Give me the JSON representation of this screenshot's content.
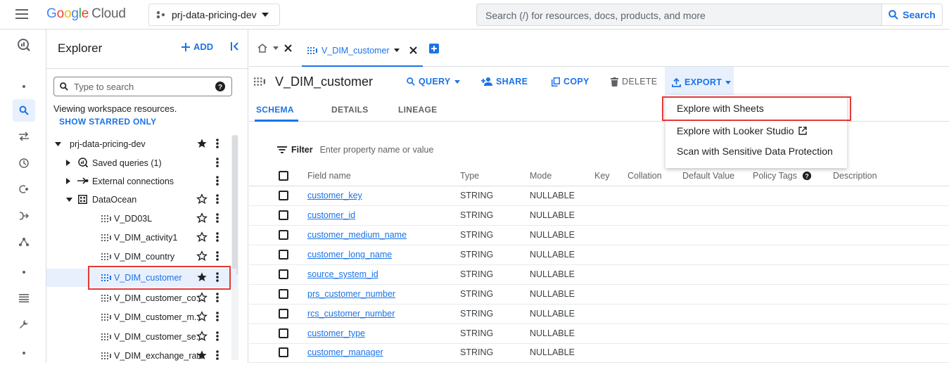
{
  "topbar": {
    "logo_g": "G",
    "logo_o1": "o",
    "logo_o2": "o",
    "logo_g2": "g",
    "logo_l": "l",
    "logo_e": "e",
    "logo_cloud": "Cloud",
    "project": "prj-data-pricing-dev",
    "search_placeholder": "Search (/) for resources, docs, products, and more",
    "search_button": "Search"
  },
  "rail": {
    "icons": [
      "bigquery-logo-icon",
      "dot-icon",
      "search-icon",
      "transfer-icon",
      "history-icon",
      "analytics-hub-icon",
      "dataflow-icon",
      "graph-icon",
      "dot-icon",
      "list-icon",
      "wrench-icon",
      "dot-icon"
    ]
  },
  "explorer": {
    "title": "Explorer",
    "add_label": "ADD",
    "search_placeholder": "Type to search",
    "workspace_text": "Viewing workspace resources.",
    "show_starred": "SHOW STARRED ONLY",
    "tree": [
      {
        "label": "prj-data-pricing-dev",
        "starred": true
      },
      {
        "label": "Saved queries (1)"
      },
      {
        "label": "External connections"
      },
      {
        "label": "DataOcean",
        "starred": false
      },
      {
        "label": "V_DD03L",
        "starred": false
      },
      {
        "label": "V_DIM_activity1",
        "starred": false
      },
      {
        "label": "V_DIM_country",
        "starred": false
      },
      {
        "label": "V_DIM_customer",
        "starred": true
      },
      {
        "label": "V_DIM_customer_co...",
        "starred": false
      },
      {
        "label": "V_DIM_customer_m...",
        "starred": false
      },
      {
        "label": "V_DIM_customer_se...",
        "starred": false
      },
      {
        "label": "V_DIM_exchange_rate",
        "starred": true
      }
    ]
  },
  "tabs": {
    "active": "V_DIM_customer"
  },
  "toolbar": {
    "title": "V_DIM_customer",
    "query": "QUERY",
    "share": "SHARE",
    "copy": "COPY",
    "delete": "DELETE",
    "export": "EXPORT"
  },
  "subtabs": [
    "SCHEMA",
    "DETAILS",
    "LINEAGE"
  ],
  "filter": {
    "label": "Filter",
    "placeholder": "Enter property name or value"
  },
  "table": {
    "headers": [
      "Field name",
      "Type",
      "Mode",
      "Key",
      "Collation",
      "Default Value",
      "Policy Tags",
      "Description"
    ],
    "rows": [
      {
        "name": "customer_key",
        "type": "STRING",
        "mode": "NULLABLE"
      },
      {
        "name": "customer_id",
        "type": "STRING",
        "mode": "NULLABLE"
      },
      {
        "name": "customer_medium_name",
        "type": "STRING",
        "mode": "NULLABLE"
      },
      {
        "name": "customer_long_name",
        "type": "STRING",
        "mode": "NULLABLE"
      },
      {
        "name": "source_system_id",
        "type": "STRING",
        "mode": "NULLABLE"
      },
      {
        "name": "prs_customer_number",
        "type": "STRING",
        "mode": "NULLABLE"
      },
      {
        "name": "rcs_customer_number",
        "type": "STRING",
        "mode": "NULLABLE"
      },
      {
        "name": "customer_type",
        "type": "STRING",
        "mode": "NULLABLE"
      },
      {
        "name": "customer_manager",
        "type": "STRING",
        "mode": "NULLABLE"
      }
    ]
  },
  "export_menu": {
    "items": [
      "Explore with Sheets",
      "Explore with Looker Studio",
      "Scan with Sensitive Data Protection"
    ]
  },
  "colors": {
    "accent": "#1a73e8",
    "highlight": "#e53935"
  }
}
